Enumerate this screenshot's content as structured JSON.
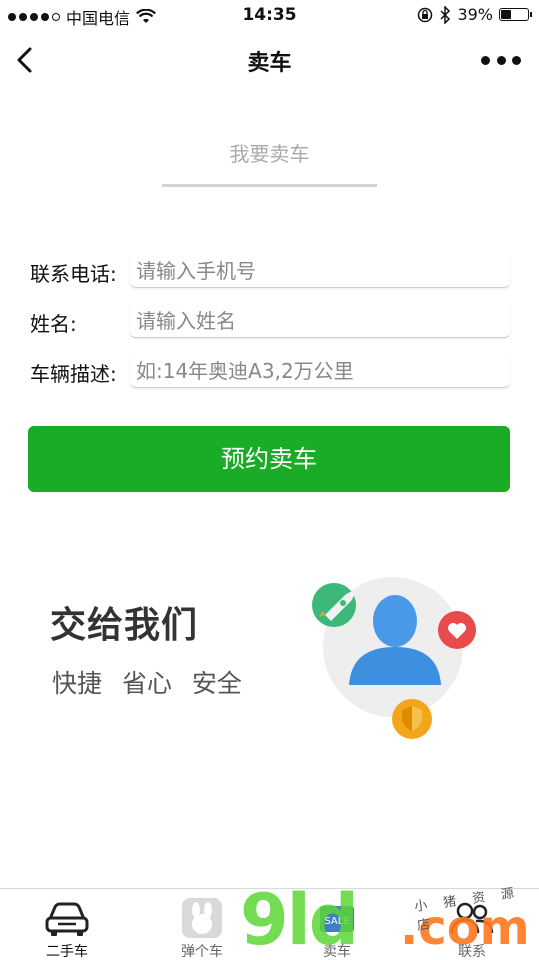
{
  "status_bar": {
    "carrier": "中国电信",
    "time": "14:35",
    "battery_percent": "39%",
    "battery_level": 0.39,
    "icons": [
      "signal-dots-icon",
      "wifi-icon",
      "orientation-lock-icon",
      "bluetooth-icon",
      "battery-icon"
    ]
  },
  "nav": {
    "title": "卖车",
    "back_icon": "chevron-left-icon",
    "more_icon": "more-dots-icon"
  },
  "header": {
    "tab_label": "我要卖车"
  },
  "form": {
    "phone": {
      "label": "联系电话:",
      "placeholder": "请输入手机号",
      "value": ""
    },
    "name": {
      "label": "姓名:",
      "placeholder": "请输入姓名",
      "value": ""
    },
    "description": {
      "label": "车辆描述:",
      "placeholder": "如:14年奥迪A3,2万公里",
      "value": ""
    },
    "submit_label": "预约卖车"
  },
  "promo": {
    "title": "交给我们",
    "subtitle": "快捷 省心 安全",
    "graphic_icons": [
      "user-silhouette-icon",
      "rocket-icon",
      "heart-icon",
      "shield-icon"
    ]
  },
  "tab_bar": {
    "items": [
      {
        "label": "二手车",
        "icon": "car-icon",
        "active": true
      },
      {
        "label": "弹个车",
        "icon": "rabbit-app-icon",
        "active": false
      },
      {
        "label": "卖车",
        "icon": "sale-icon",
        "active": false
      },
      {
        "label": "联系",
        "icon": "contacts-icon",
        "active": false
      }
    ]
  },
  "watermark": {
    "main": "9ld",
    "domain": ".com",
    "small": "小 猪 资 源 店"
  },
  "colors": {
    "accent_green": "#1aab27",
    "promo_circle": "#eeeeee",
    "user_blue": "#3f8fe0",
    "rocket_green": "#3bb87a",
    "heart_red": "#e84b4b",
    "shield_orange": "#f3a51c"
  }
}
